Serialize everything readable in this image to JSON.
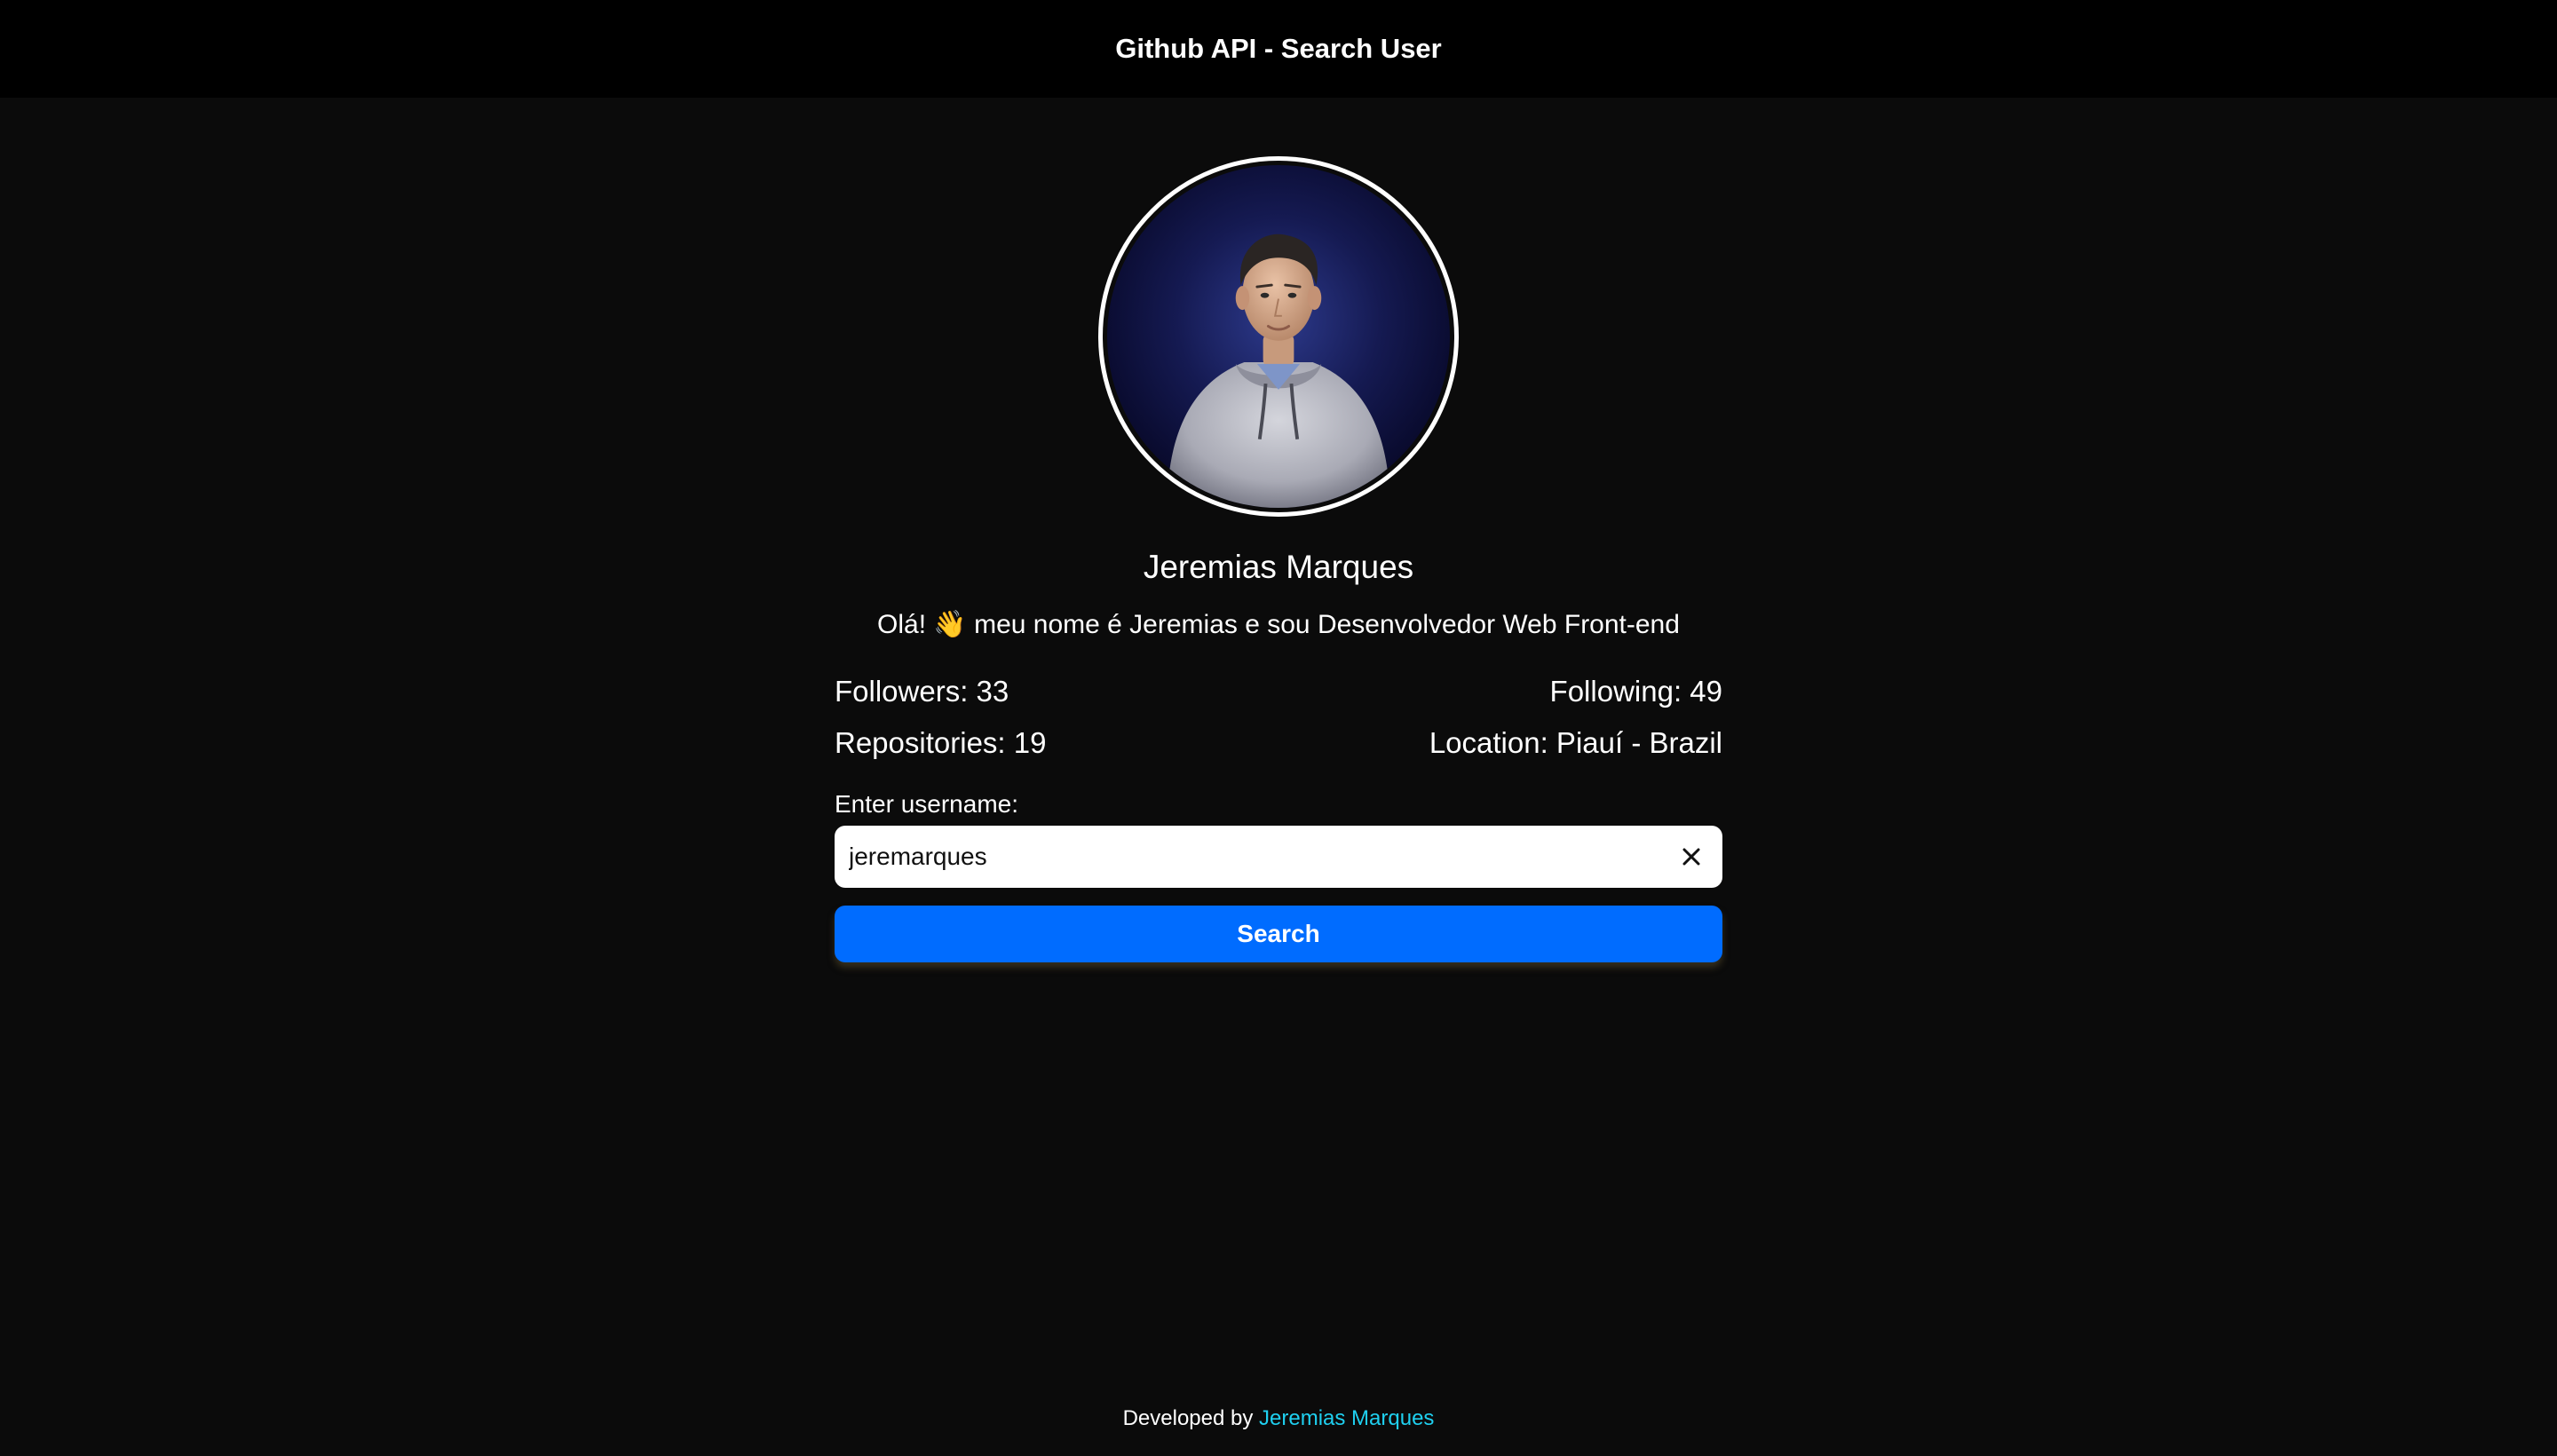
{
  "header": {
    "title": "Github API - Search User"
  },
  "profile": {
    "avatar_alt": "avatar",
    "name": "Jeremias Marques",
    "bio": "Olá! 👋 meu nome é Jeremias e sou Desenvolvedor Web Front-end",
    "followers": "Followers: 33",
    "following": "Following: 49",
    "repositories": "Repositories: 19",
    "location": "Location: Piauí - Brazil"
  },
  "search": {
    "label": "Enter username:",
    "value": "jeremarques",
    "clear_icon": "close-icon",
    "button_label": "Search"
  },
  "footer": {
    "prefix": "Developed by ",
    "link_text": "Jeremias Marques"
  },
  "colors": {
    "header_bg": "#000000",
    "page_bg": "#0b0b0b",
    "button_bg": "#006cff",
    "link": "#1fd0f0"
  }
}
